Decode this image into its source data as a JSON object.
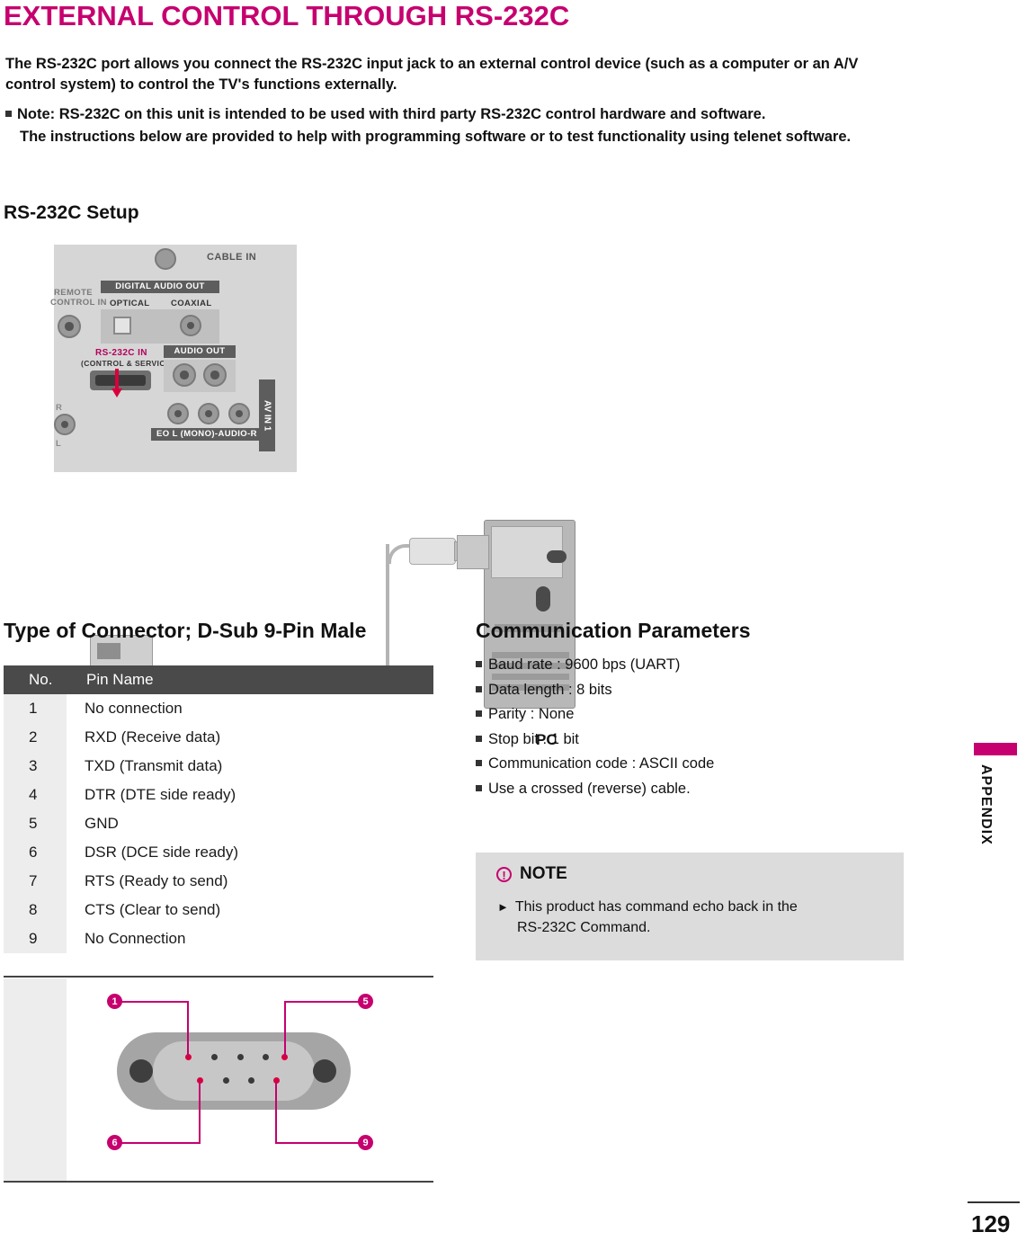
{
  "title": "EXTERNAL CONTROL THROUGH RS-232C",
  "intro": {
    "paragraph": "The RS-232C port allows you connect the RS-232C input jack to an external control device (such as a computer or an A/V control system) to control the TV's functions externally.",
    "note_line1": "Note: RS-232C on this unit is intended to be used with third party RS-232C control hardware and software.",
    "note_line2": "The instructions below are provided to help with programming software or to test functionality using telenet software."
  },
  "headings": {
    "setup": "RS-232C Setup",
    "connector": "Type of Connector; D-Sub 9-Pin Male",
    "comm": "Communication Parameters"
  },
  "diagram": {
    "cable_in": "CABLE IN",
    "digital_audio_out": "DIGITAL AUDIO OUT",
    "optical": "OPTICAL",
    "coaxial": "COAXIAL",
    "remote_control_in_1": "REMOTE",
    "remote_control_in_2": "CONTROL IN",
    "rs232c_in": "RS-232C IN",
    "rs232c_sub": "(CONTROL & SERVICE)",
    "audio_out": "AUDIO OUT",
    "av_in_1": "AV IN 1",
    "video_audio": "EO  L (MONO)-AUDIO-R",
    "r_label": "R",
    "l_label": "L",
    "pc_label": "PC"
  },
  "pin_table": {
    "headers": [
      "No.",
      "Pin Name"
    ],
    "rows": [
      {
        "no": "1",
        "name": "No connection"
      },
      {
        "no": "2",
        "name": "RXD (Receive data)"
      },
      {
        "no": "3",
        "name": "TXD (Transmit data)"
      },
      {
        "no": "4",
        "name": "DTR (DTE side ready)"
      },
      {
        "no": "5",
        "name": "GND"
      },
      {
        "no": "6",
        "name": "DSR (DCE side ready)"
      },
      {
        "no": "7",
        "name": "RTS (Ready to send)"
      },
      {
        "no": "8",
        "name": "CTS (Clear to send)"
      },
      {
        "no": "9",
        "name": "No Connection"
      }
    ]
  },
  "dsub_labels": {
    "p1": "1",
    "p5": "5",
    "p6": "6",
    "p9": "9"
  },
  "comm_params": [
    "Baud rate : 9600 bps (UART)",
    "Data length : 8 bits",
    "Parity : None",
    "Stop bit : 1 bit",
    "Communication code : ASCII code",
    "Use a crossed (reverse) cable."
  ],
  "note_box": {
    "icon": "!",
    "title": "NOTE",
    "line1": "This  product  has  command  echo  back  in  the",
    "line2": "RS-232C Command."
  },
  "sidebar": {
    "tab_label": "APPENDIX"
  },
  "footer": {
    "page_number": "129"
  },
  "colors": {
    "accent": "#C6006F",
    "header_bar": "#4A4A4A",
    "note_bg": "#DCDCDC"
  }
}
